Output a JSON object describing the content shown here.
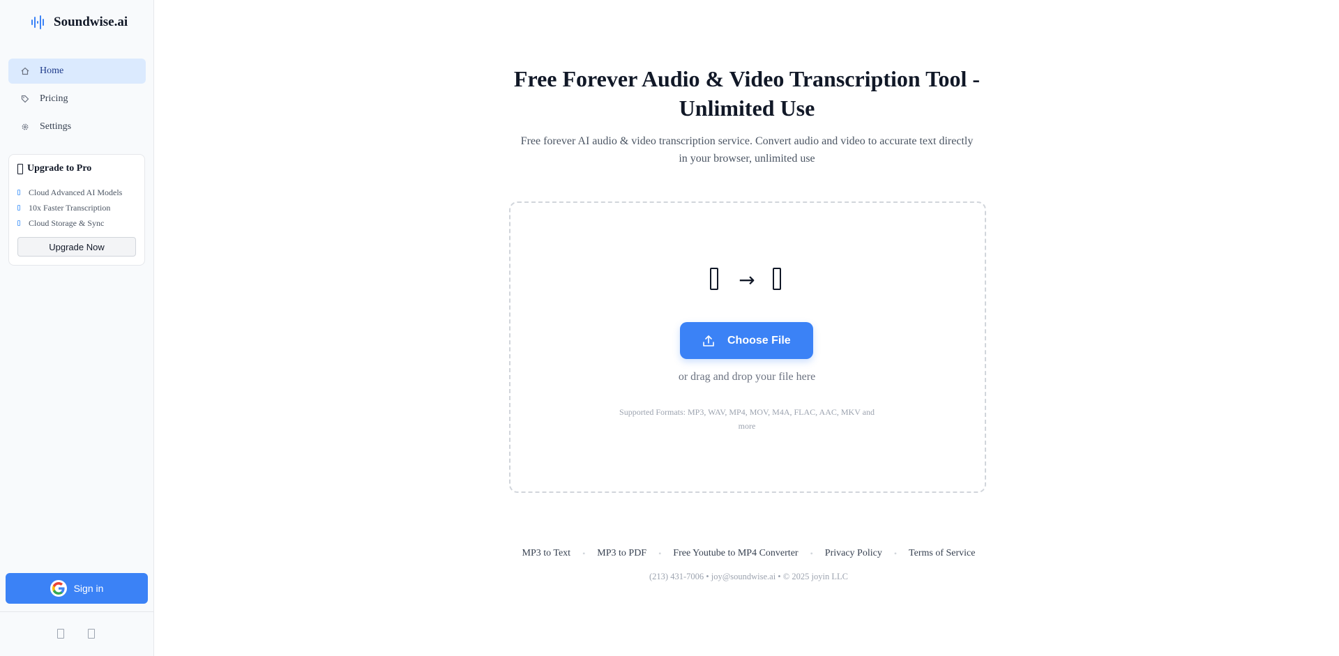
{
  "brand": {
    "name": "Soundwise.ai",
    "accent": "#3b82f6"
  },
  "sidebar": {
    "nav": [
      {
        "label": "Home",
        "icon": "home-icon",
        "active": true
      },
      {
        "label": "Pricing",
        "icon": "tag-icon",
        "active": false
      },
      {
        "label": "Settings",
        "icon": "gear-icon",
        "active": false
      }
    ],
    "upgrade": {
      "title": "Upgrade to Pro",
      "features": [
        "Cloud Advanced AI Models",
        "10x Faster Transcription",
        "Cloud Storage & Sync"
      ],
      "button_label": "Upgrade Now"
    },
    "signin_label": "Sign in"
  },
  "main": {
    "title_line1": "Free Forever Audio & Video Transcription Tool -",
    "title_line2": "Unlimited Use",
    "subtitle_line1": "Free forever AI audio & video transcription service. Convert audio and video to accurate text directly",
    "subtitle_line2": "in your browser, unlimited use",
    "upload": {
      "arrow": "→",
      "button_label": "Choose File",
      "drag_text": "or drag and drop your file here",
      "formats_line1": "Supported Formats: MP3, WAV, MP4, MOV, M4A, FLAC, AAC, MKV and",
      "formats_line2": "more"
    }
  },
  "footer": {
    "links": [
      "MP3 to Text",
      "MP3 to PDF",
      "Free Youtube to MP4 Converter",
      "Privacy Policy",
      "Terms of Service"
    ],
    "separator": "•",
    "contact": "(213) 431-7006 • joy@soundwise.ai • © 2025 joyin LLC"
  }
}
